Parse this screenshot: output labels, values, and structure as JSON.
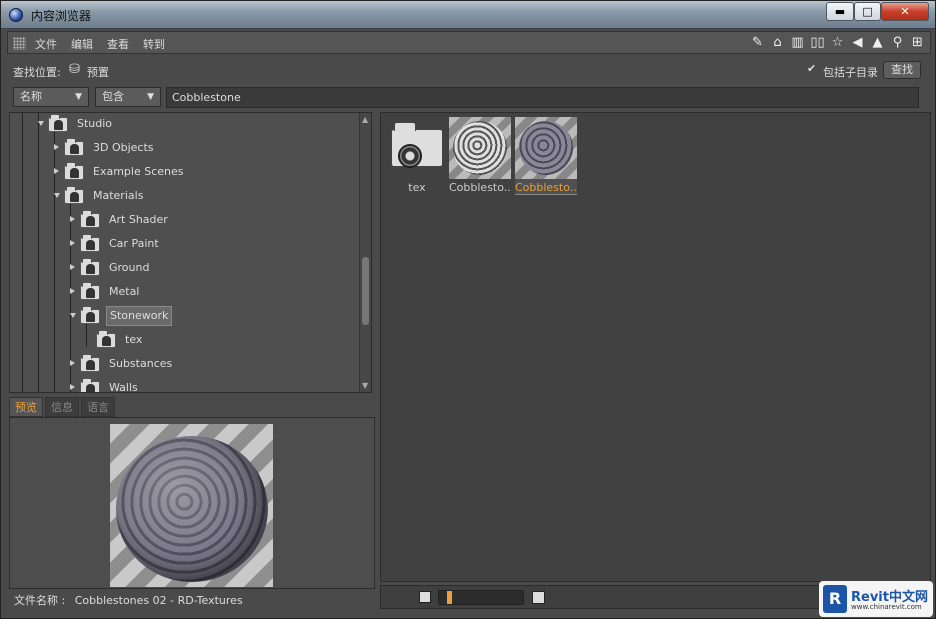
{
  "window": {
    "title": "内容浏览器",
    "controls": {
      "minimize": "▬",
      "maximize": "□",
      "close": "✕"
    }
  },
  "menubar": {
    "items": [
      "文件",
      "编辑",
      "查看",
      "转到"
    ],
    "toolbar_icons": [
      "edit-icon",
      "home-icon",
      "bin-icon",
      "book-icon",
      "star-icon",
      "back-icon",
      "up-icon",
      "search-icon",
      "add-icon"
    ]
  },
  "search": {
    "location_label": "查找位置:",
    "location_value": "预置",
    "include_sub_checked": true,
    "include_sub_label": "包括子目录",
    "search_button": "查找"
  },
  "filter": {
    "field": "名称",
    "match": "包含",
    "query": "Cobblestone"
  },
  "tree": {
    "nodes": [
      {
        "label": "Studio",
        "level": 0,
        "expanded": true
      },
      {
        "label": "3D Objects",
        "level": 1
      },
      {
        "label": "Example Scenes",
        "level": 1
      },
      {
        "label": "Materials",
        "level": 1,
        "expanded": true
      },
      {
        "label": "Art Shader",
        "level": 2
      },
      {
        "label": "Car Paint",
        "level": 2
      },
      {
        "label": "Ground",
        "level": 2
      },
      {
        "label": "Metal",
        "level": 2
      },
      {
        "label": "Stonework",
        "level": 2,
        "expanded": true,
        "selected": true
      },
      {
        "label": "tex",
        "level": 3
      },
      {
        "label": "Substances",
        "level": 2
      },
      {
        "label": "Walls",
        "level": 2
      }
    ]
  },
  "tabs": [
    "预览",
    "信息",
    "语言"
  ],
  "preview": {
    "filename_label": "文件名称 :",
    "filename_value": "Cobblestones 02 - RD-Textures"
  },
  "content": {
    "items": [
      {
        "label": "tex",
        "type": "folder"
      },
      {
        "label": "Cobblesto...",
        "type": "material"
      },
      {
        "label": "Cobblesto...",
        "type": "material",
        "selected": true
      }
    ]
  },
  "watermark": {
    "logo": "R",
    "text": "Revit中文网",
    "sub": "www.chinarevit.com"
  },
  "colors": {
    "accent": "#e8a13c",
    "panel": "#4a4a4a"
  }
}
